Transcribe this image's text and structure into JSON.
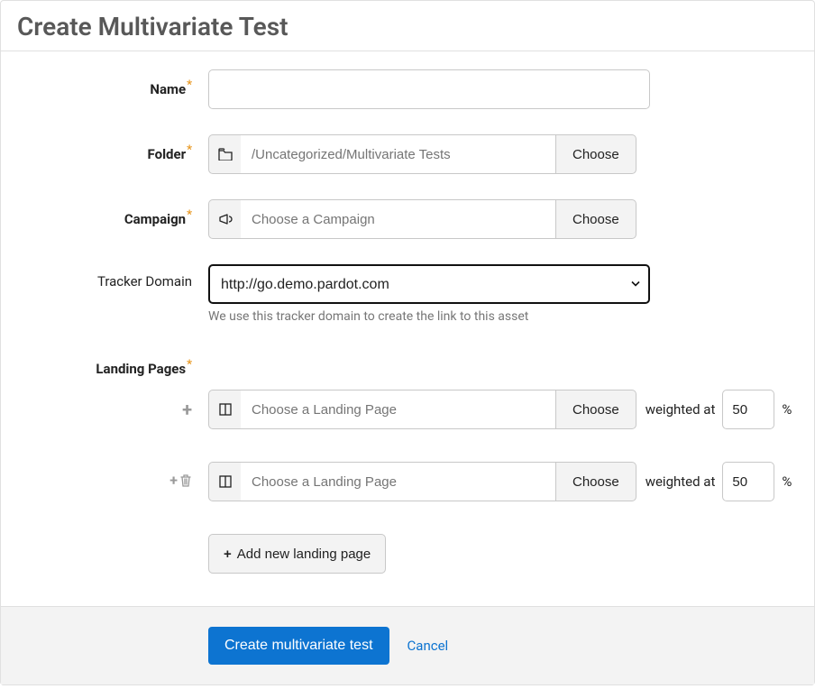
{
  "title": "Create Multivariate Test",
  "fields": {
    "name": {
      "label": "Name",
      "value": ""
    },
    "folder": {
      "label": "Folder",
      "placeholder": "/Uncategorized/Multivariate Tests",
      "choose": "Choose"
    },
    "campaign": {
      "label": "Campaign",
      "placeholder": "Choose a Campaign",
      "choose": "Choose"
    },
    "trackerDomain": {
      "label": "Tracker Domain",
      "value": "http://go.demo.pardot.com",
      "help": "We use this tracker domain to create the link to this asset"
    },
    "landingPages": {
      "label": "Landing Pages",
      "placeholder": "Choose a Landing Page",
      "choose": "Choose",
      "weightedAt": "weighted at",
      "percent": "%",
      "items": [
        {
          "weight": "50"
        },
        {
          "weight": "50"
        }
      ],
      "addButton": "Add new landing page"
    }
  },
  "actions": {
    "submit": "Create multivariate test",
    "cancel": "Cancel"
  }
}
